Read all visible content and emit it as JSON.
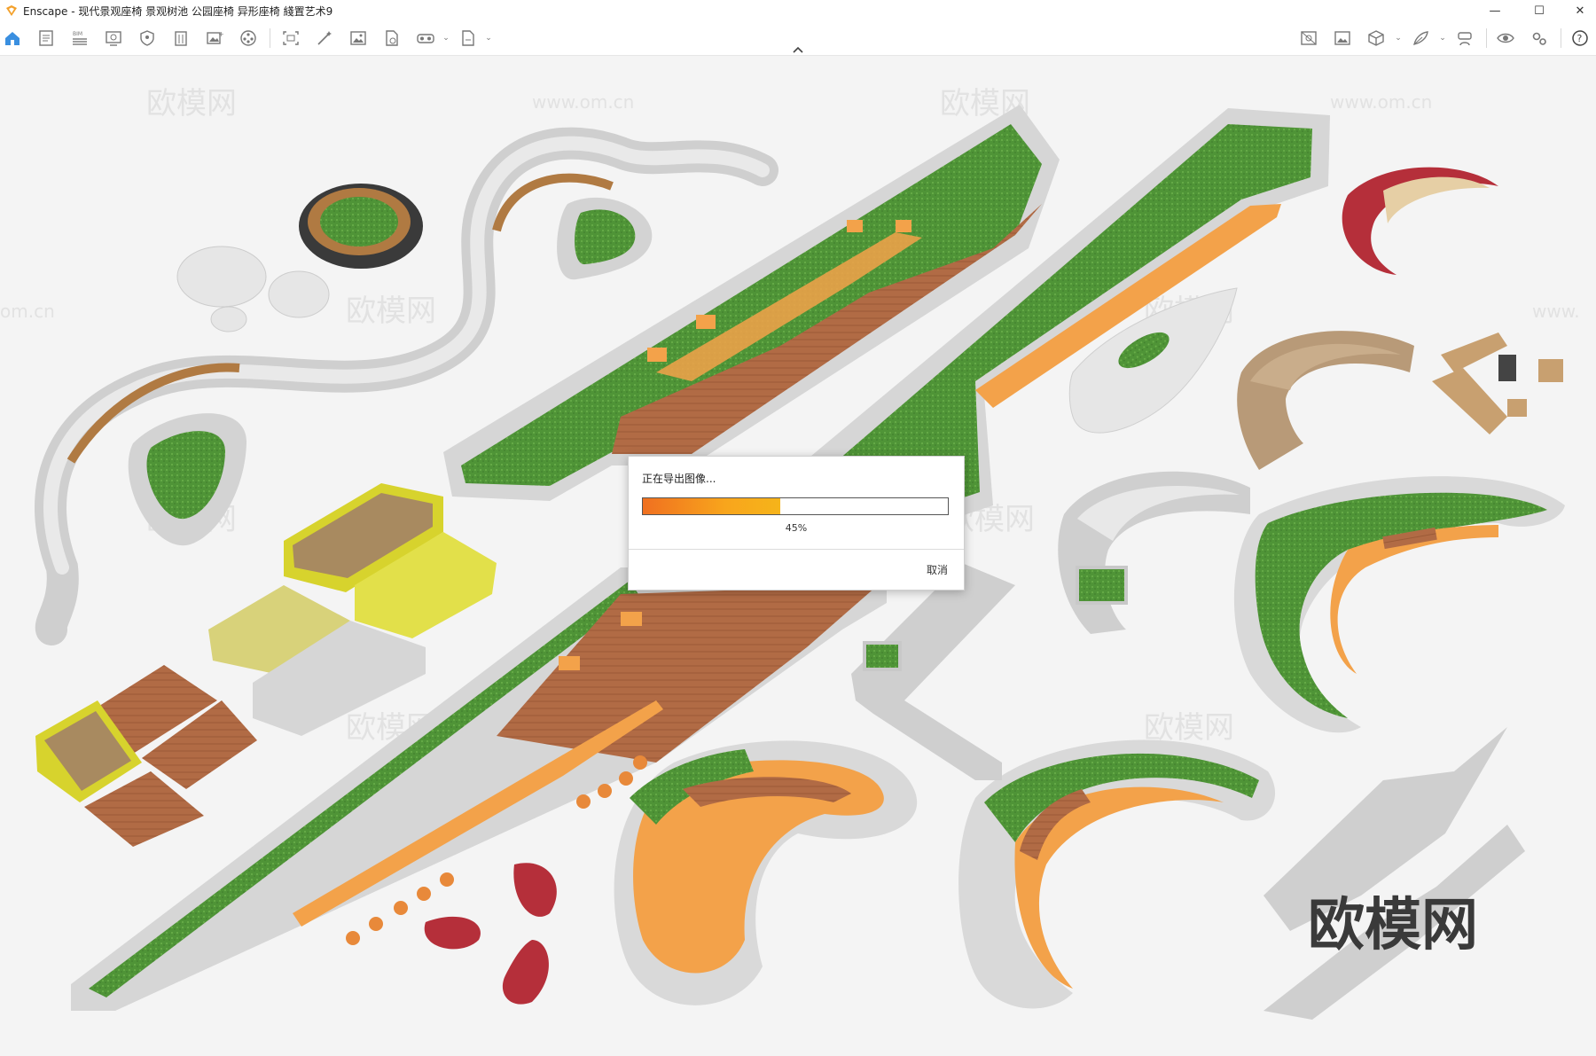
{
  "window": {
    "app_name": "Enscape",
    "title": "Enscape - 现代景观座椅 景观树池 公园座椅 异形座椅 綫置艺术9",
    "controls": {
      "minimize": "—",
      "maximize": "☐",
      "close": "✕"
    }
  },
  "toolbar": {
    "left_tools": [
      "home-icon",
      "document-icon",
      "bim-icon",
      "screen-icon",
      "shield-icon",
      "building-icon",
      "image-plus-icon",
      "film-reel-icon",
      "capture-icon",
      "magic-wand-icon",
      "picture-icon",
      "export-file-icon",
      "vr-headset-icon",
      "page-icon"
    ],
    "right_tools": [
      "asset-library-icon",
      "gallery-icon",
      "cube-icon",
      "feather-icon",
      "vr-person-icon",
      "eye-icon",
      "settings-icon",
      "help-icon"
    ],
    "accent": "#3a8fe0"
  },
  "dialog": {
    "title": "正在导出图像...",
    "progress_percent": 45,
    "progress_label": "45%",
    "cancel_label": "取消",
    "progress_colors": [
      "#f07020",
      "#f6b41a"
    ]
  },
  "watermarks": {
    "brand": "欧模网",
    "url": "www.om.cn",
    "url_fragment_left": "om.cn",
    "url_fragment_right": "www."
  },
  "scene": {
    "colors": {
      "concrete": "#d6d6d6",
      "grass": "#4f9437",
      "wood": "#b16b45",
      "orange": "#f3a24a",
      "yellow": "#d9d63a",
      "red": "#b52f3a",
      "tan": "#b89a78"
    }
  }
}
